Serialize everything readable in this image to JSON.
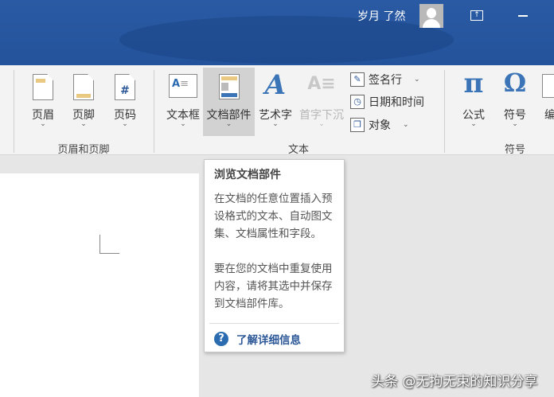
{
  "titlebar": {
    "user_name": "岁月 了然",
    "restore_icon": "ribbon-display-icon",
    "minimize_icon": "minimize-icon"
  },
  "ribbon": {
    "header_footer": {
      "group_label": "页眉和页脚",
      "header": "页眉",
      "footer": "页脚",
      "page_number": "页码"
    },
    "text": {
      "group_label": "文本",
      "text_box": "文本框",
      "quick_parts": "文档部件",
      "wordart": "艺术字",
      "drop_cap": "首字下沉",
      "signature_line": "签名行",
      "date_time": "日期和时间",
      "object": "对象"
    },
    "symbols": {
      "group_label": "符号",
      "equation": "公式",
      "symbol": "符号",
      "numbering": "编"
    },
    "chevron": "⌄"
  },
  "tooltip": {
    "title": "浏览文档部件",
    "paragraph1": "在文档的任意位置插入预设格式的文本、自动图文集、文档属性和字段。",
    "paragraph2": "要在您的文档中重复使用内容，请将其选中并保存到文档部件库。",
    "link": "了解详细信息"
  },
  "watermark": "头条 @无拘无束的知识分享"
}
